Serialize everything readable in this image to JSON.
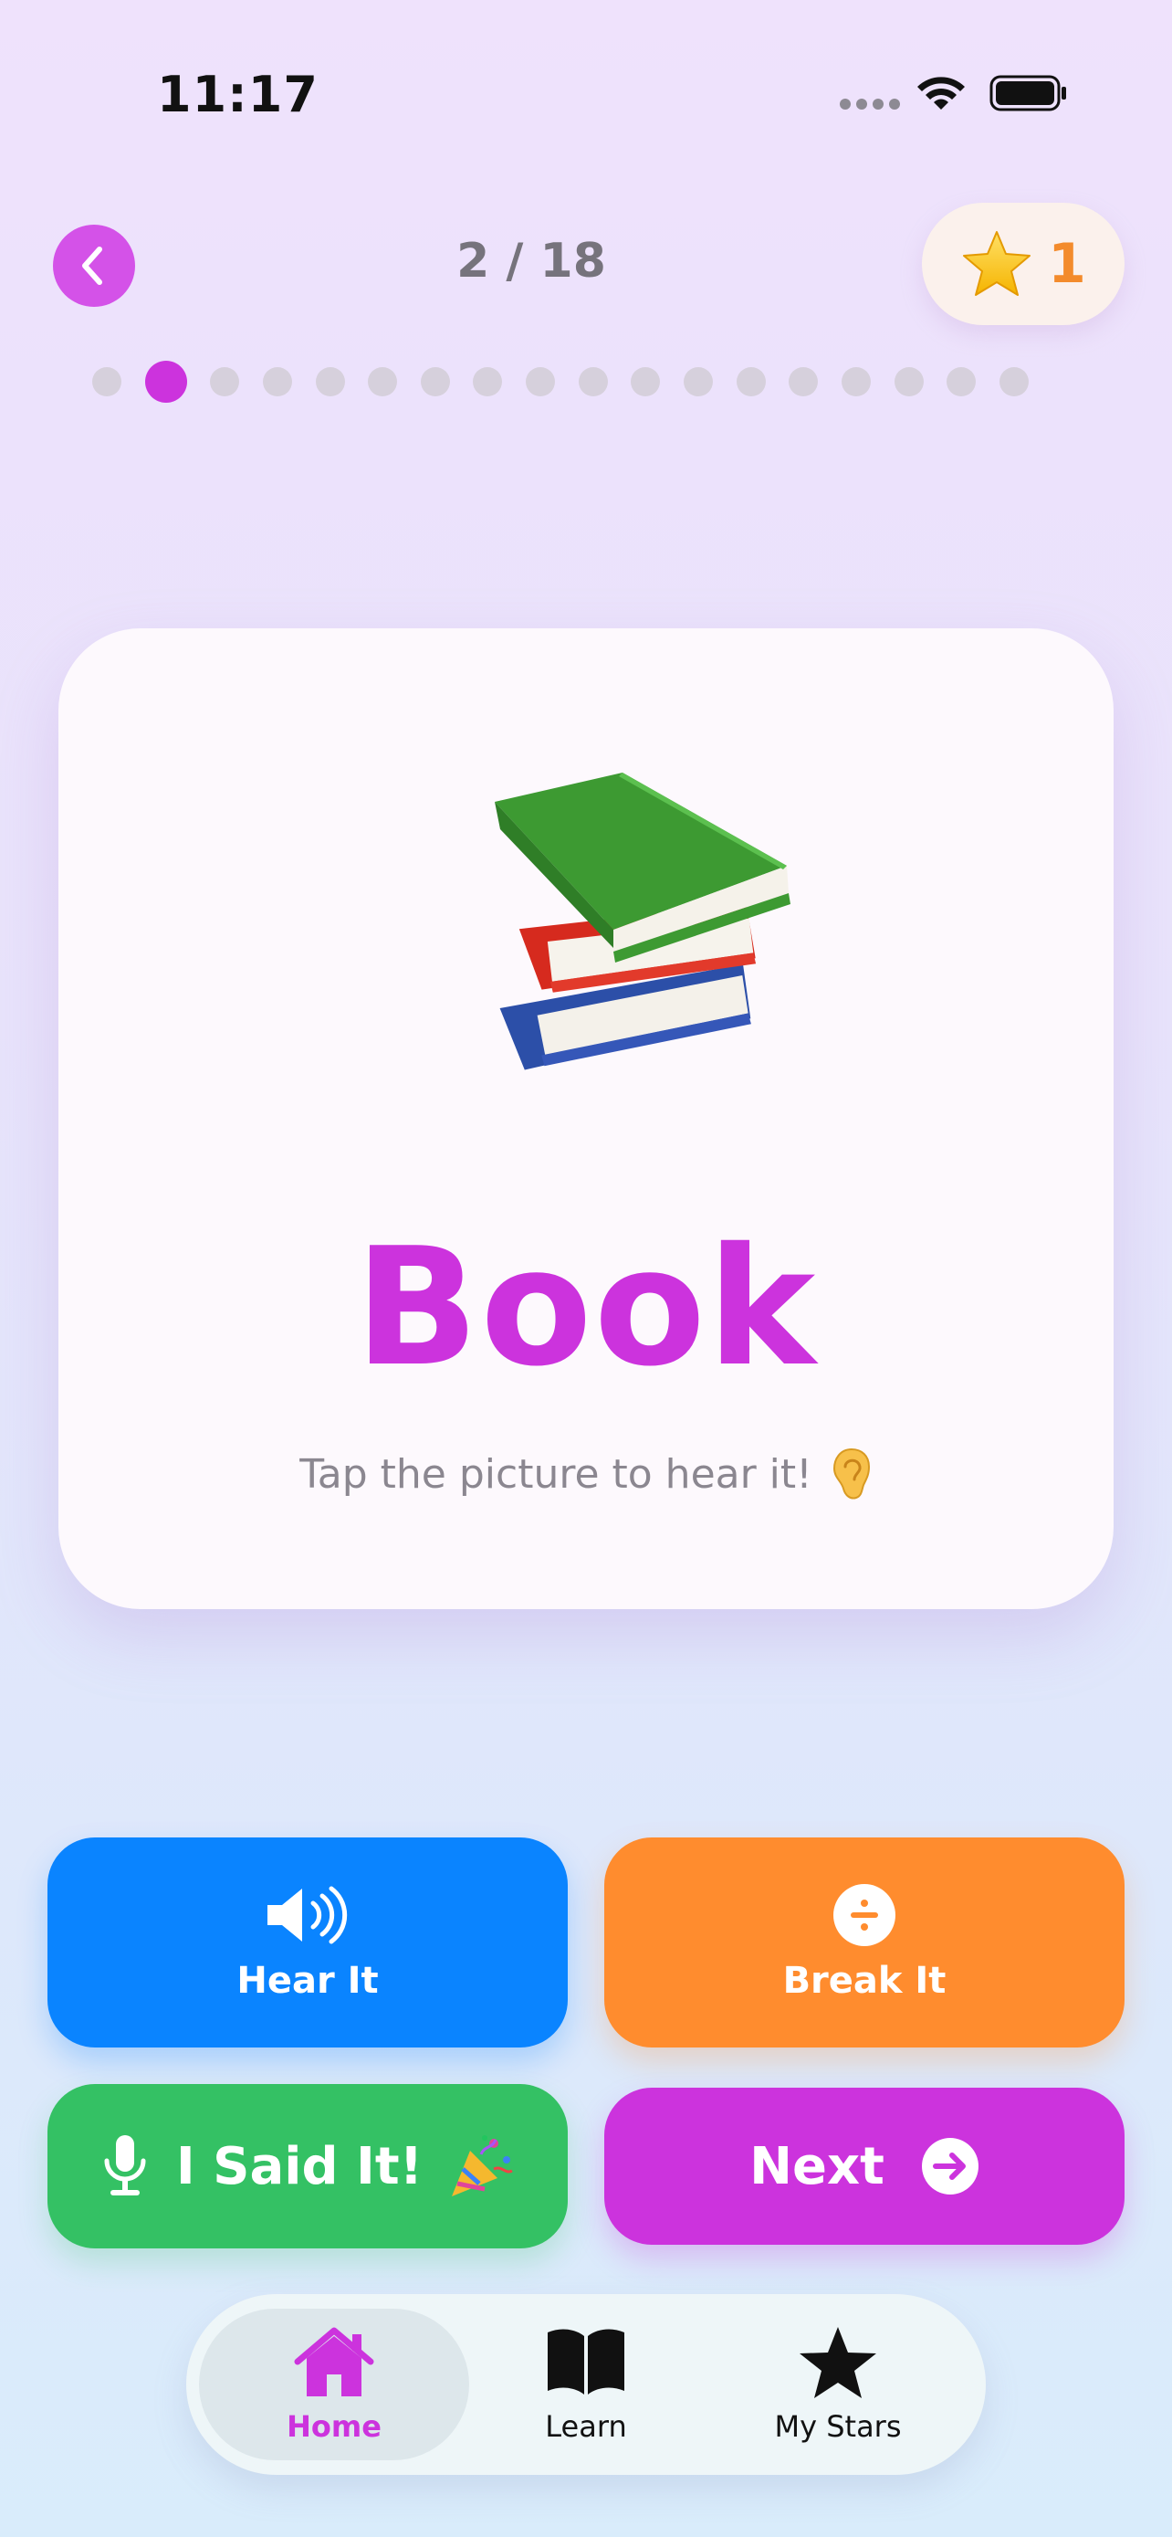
{
  "status_bar": {
    "time": "11:17"
  },
  "header": {
    "progress": "2 / 18",
    "stars_count": "1"
  },
  "progress_dots": {
    "total": 18,
    "current": 2
  },
  "card": {
    "word": "Book",
    "image": "books-icon",
    "hint": "Tap the picture to hear it!",
    "hint_icon": "ear-icon"
  },
  "actions": {
    "hear_label": "Hear It",
    "break_label": "Break It",
    "said_label": "I Said It!",
    "next_label": "Next"
  },
  "tabs": [
    {
      "label": "Home",
      "icon": "house-icon",
      "active": true
    },
    {
      "label": "Learn",
      "icon": "book-open-icon",
      "active": false
    },
    {
      "label": "My Stars",
      "icon": "star-icon",
      "active": false
    }
  ],
  "colors": {
    "accent": "#cc33dd",
    "hear": "#0a84ff",
    "break": "#ff8c2e",
    "said": "#34c164",
    "star_count": "#f38b2c"
  }
}
